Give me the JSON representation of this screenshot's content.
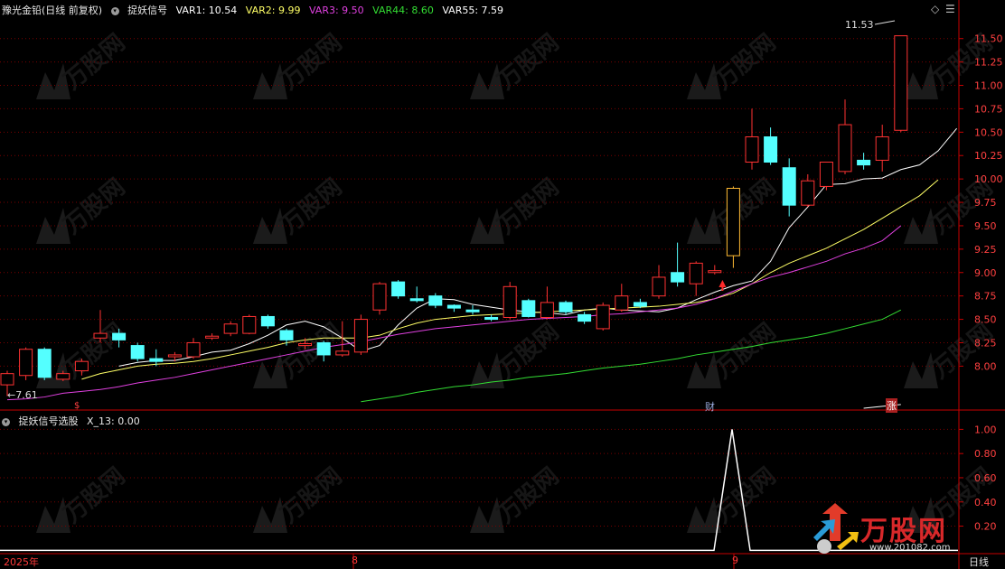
{
  "main_panel": {
    "stock_title": "豫光金铅(日线 前复权)",
    "indicator_name": "捉妖信号",
    "vars": [
      {
        "label": "VAR1: 10.54",
        "color": "#ffffff"
      },
      {
        "label": "VAR2: 9.99",
        "color": "#ffff66"
      },
      {
        "label": "VAR3: 9.50",
        "color": "#e040e0"
      },
      {
        "label": "VAR44: 8.60",
        "color": "#33dd33"
      },
      {
        "label": "VAR55: 7.59",
        "color": "#ffffff"
      }
    ],
    "high_label": "11.53",
    "low_label": "7.61",
    "markers": {
      "dollar": "$",
      "cai": "财",
      "zhang": "涨"
    },
    "controls": {
      "diamond": "◇",
      "menu": "☰"
    }
  },
  "sub_panel": {
    "indicator_name": "捉妖信号选股",
    "value_label": "X_13: 0.00"
  },
  "x_axis": {
    "labels": [
      "2025年",
      "8",
      "9"
    ],
    "period": "日线"
  },
  "watermark": {
    "brand": "万股网",
    "url": "www.201082.com"
  },
  "colors": {
    "up": "#ff3232",
    "down": "#54ffff",
    "grid": "#7a0000",
    "axis": "#c80000"
  },
  "chart_data": [
    {
      "type": "candlestick",
      "title": "",
      "y_ticks": [
        8.0,
        8.25,
        8.5,
        8.75,
        9.0,
        9.25,
        9.5,
        9.75,
        10.0,
        10.25,
        10.5,
        10.75,
        11.0,
        11.25,
        11.5
      ],
      "ylim": [
        7.55,
        11.7
      ],
      "candles": [
        {
          "o": 7.8,
          "h": 7.95,
          "l": 7.68,
          "c": 7.92
        },
        {
          "o": 7.9,
          "h": 8.2,
          "l": 7.85,
          "c": 8.18
        },
        {
          "o": 8.18,
          "h": 8.2,
          "l": 7.85,
          "c": 7.88
        },
        {
          "o": 7.86,
          "h": 7.95,
          "l": 7.84,
          "c": 7.92
        },
        {
          "o": 7.95,
          "h": 8.08,
          "l": 7.9,
          "c": 8.05
        },
        {
          "o": 8.3,
          "h": 8.6,
          "l": 8.25,
          "c": 8.35
        },
        {
          "o": 8.35,
          "h": 8.4,
          "l": 8.2,
          "c": 8.28
        },
        {
          "o": 8.22,
          "h": 8.25,
          "l": 8.05,
          "c": 8.08
        },
        {
          "o": 8.08,
          "h": 8.18,
          "l": 8.0,
          "c": 8.05
        },
        {
          "o": 8.1,
          "h": 8.15,
          "l": 8.05,
          "c": 8.12
        },
        {
          "o": 8.1,
          "h": 8.3,
          "l": 8.08,
          "c": 8.25
        },
        {
          "o": 8.3,
          "h": 8.35,
          "l": 8.28,
          "c": 8.32
        },
        {
          "o": 8.35,
          "h": 8.48,
          "l": 8.32,
          "c": 8.45
        },
        {
          "o": 8.35,
          "h": 8.55,
          "l": 8.34,
          "c": 8.53
        },
        {
          "o": 8.53,
          "h": 8.55,
          "l": 8.4,
          "c": 8.43
        },
        {
          "o": 8.38,
          "h": 8.4,
          "l": 8.22,
          "c": 8.28
        },
        {
          "o": 8.22,
          "h": 8.3,
          "l": 8.18,
          "c": 8.24
        },
        {
          "o": 8.25,
          "h": 8.27,
          "l": 8.05,
          "c": 8.12
        },
        {
          "o": 8.12,
          "h": 8.48,
          "l": 8.1,
          "c": 8.16
        },
        {
          "o": 8.15,
          "h": 8.55,
          "l": 8.12,
          "c": 8.5
        },
        {
          "o": 8.6,
          "h": 8.9,
          "l": 8.55,
          "c": 8.88
        },
        {
          "o": 8.9,
          "h": 8.92,
          "l": 8.72,
          "c": 8.75
        },
        {
          "o": 8.72,
          "h": 8.85,
          "l": 8.68,
          "c": 8.7
        },
        {
          "o": 8.75,
          "h": 8.78,
          "l": 8.62,
          "c": 8.65
        },
        {
          "o": 8.65,
          "h": 8.66,
          "l": 8.58,
          "c": 8.62
        },
        {
          "o": 8.6,
          "h": 8.65,
          "l": 8.55,
          "c": 8.58
        },
        {
          "o": 8.52,
          "h": 8.55,
          "l": 8.48,
          "c": 8.5
        },
        {
          "o": 8.52,
          "h": 8.9,
          "l": 8.5,
          "c": 8.85
        },
        {
          "o": 8.7,
          "h": 8.72,
          "l": 8.52,
          "c": 8.53
        },
        {
          "o": 8.52,
          "h": 8.85,
          "l": 8.5,
          "c": 8.68
        },
        {
          "o": 8.68,
          "h": 8.7,
          "l": 8.55,
          "c": 8.58
        },
        {
          "o": 8.55,
          "h": 8.58,
          "l": 8.45,
          "c": 8.48
        },
        {
          "o": 8.4,
          "h": 8.68,
          "l": 8.38,
          "c": 8.65
        },
        {
          "o": 8.6,
          "h": 8.88,
          "l": 8.58,
          "c": 8.75
        },
        {
          "o": 8.68,
          "h": 8.72,
          "l": 8.62,
          "c": 8.64
        },
        {
          "o": 8.75,
          "h": 9.08,
          "l": 8.72,
          "c": 8.95
        },
        {
          "o": 9.0,
          "h": 9.32,
          "l": 8.85,
          "c": 8.9
        },
        {
          "o": 8.88,
          "h": 9.12,
          "l": 8.75,
          "c": 9.1
        },
        {
          "o": 9.0,
          "h": 9.08,
          "l": 8.98,
          "c": 9.02
        },
        {
          "o": 9.18,
          "h": 9.92,
          "l": 9.05,
          "c": 9.9
        },
        {
          "o": 10.18,
          "h": 10.75,
          "l": 10.1,
          "c": 10.45
        },
        {
          "o": 10.45,
          "h": 10.55,
          "l": 10.15,
          "c": 10.18
        },
        {
          "o": 10.12,
          "h": 10.22,
          "l": 9.6,
          "c": 9.72
        },
        {
          "o": 9.72,
          "h": 10.05,
          "l": 9.7,
          "c": 9.98
        },
        {
          "o": 9.92,
          "h": 10.18,
          "l": 9.88,
          "c": 10.18
        },
        {
          "o": 10.08,
          "h": 10.85,
          "l": 10.05,
          "c": 10.58
        },
        {
          "o": 10.2,
          "h": 10.28,
          "l": 10.1,
          "c": 10.15
        },
        {
          "o": 10.2,
          "h": 10.58,
          "l": 10.08,
          "c": 10.45
        },
        {
          "o": 10.52,
          "h": 11.53,
          "l": 10.5,
          "c": 11.53
        }
      ],
      "series": [
        {
          "name": "VAR1",
          "color": "#ffffff",
          "start": 6,
          "values": [
            8.0,
            8.04,
            8.06,
            8.06,
            8.1,
            8.15,
            8.17,
            8.24,
            8.33,
            8.44,
            8.48,
            8.42,
            8.3,
            8.16,
            8.22,
            8.44,
            8.62,
            8.72,
            8.71,
            8.66,
            8.63,
            8.6,
            8.58,
            8.57,
            8.55,
            8.6,
            8.62,
            8.6,
            8.59,
            8.58,
            8.62,
            8.71,
            8.79,
            8.86,
            8.91,
            9.12,
            9.48,
            9.7,
            9.94,
            9.95,
            10.0,
            10.01,
            10.1,
            10.15,
            10.3,
            10.54
          ]
        },
        {
          "name": "VAR2",
          "color": "#ffff66",
          "start": 4,
          "values": [
            7.86,
            7.92,
            7.96,
            8.0,
            8.02,
            8.03,
            8.05,
            8.08,
            8.12,
            8.16,
            8.2,
            8.25,
            8.28,
            8.3,
            8.3,
            8.3,
            8.33,
            8.4,
            8.46,
            8.5,
            8.52,
            8.54,
            8.55,
            8.56,
            8.57,
            8.58,
            8.59,
            8.6,
            8.61,
            8.62,
            8.63,
            8.64,
            8.66,
            8.68,
            8.72,
            8.78,
            8.88,
            9.0,
            9.1,
            9.18,
            9.26,
            9.36,
            9.46,
            9.58,
            9.7,
            9.82,
            9.99
          ]
        },
        {
          "name": "VAR3",
          "color": "#e040e0",
          "start": 0,
          "values": [
            7.64,
            7.65,
            7.67,
            7.71,
            7.73,
            7.75,
            7.78,
            7.82,
            7.85,
            7.88,
            7.92,
            7.96,
            8.0,
            8.04,
            8.08,
            8.12,
            8.16,
            8.2,
            8.23,
            8.26,
            8.3,
            8.34,
            8.37,
            8.4,
            8.42,
            8.44,
            8.46,
            8.48,
            8.5,
            8.51,
            8.52,
            8.53,
            8.55,
            8.56,
            8.58,
            8.6,
            8.62,
            8.66,
            8.72,
            8.8,
            8.88,
            8.95,
            9.0,
            9.06,
            9.12,
            9.2,
            9.26,
            9.34,
            9.5
          ]
        },
        {
          "name": "VAR44",
          "color": "#33dd33",
          "start": 19,
          "values": [
            7.62,
            7.65,
            7.68,
            7.72,
            7.75,
            7.78,
            7.8,
            7.83,
            7.85,
            7.88,
            7.9,
            7.92,
            7.95,
            7.98,
            8.0,
            8.02,
            8.05,
            8.08,
            8.12,
            8.15,
            8.18,
            8.21,
            8.25,
            8.28,
            8.31,
            8.35,
            8.4,
            8.45,
            8.5,
            8.6
          ]
        },
        {
          "name": "VAR55",
          "color": "#ffffff",
          "start": 46,
          "values": [
            7.55,
            7.57,
            7.59
          ]
        }
      ]
    },
    {
      "type": "line",
      "title": "",
      "y_ticks": [
        0.2,
        0.4,
        0.6,
        0.8,
        1.0
      ],
      "ylim": [
        -0.02,
        1.1
      ],
      "series": [
        {
          "name": "X_13",
          "color": "#ffffff",
          "values": [
            0,
            0,
            0,
            0,
            0,
            0,
            0,
            0,
            0,
            0,
            0,
            0,
            0,
            0,
            0,
            0,
            0,
            0,
            0,
            0,
            0,
            0,
            0,
            0,
            0,
            0,
            0,
            0,
            0,
            0,
            0,
            0,
            0,
            0,
            0,
            0,
            0,
            0,
            0,
            1,
            0,
            0,
            0,
            0,
            0,
            0,
            0,
            0,
            0
          ]
        }
      ]
    }
  ]
}
